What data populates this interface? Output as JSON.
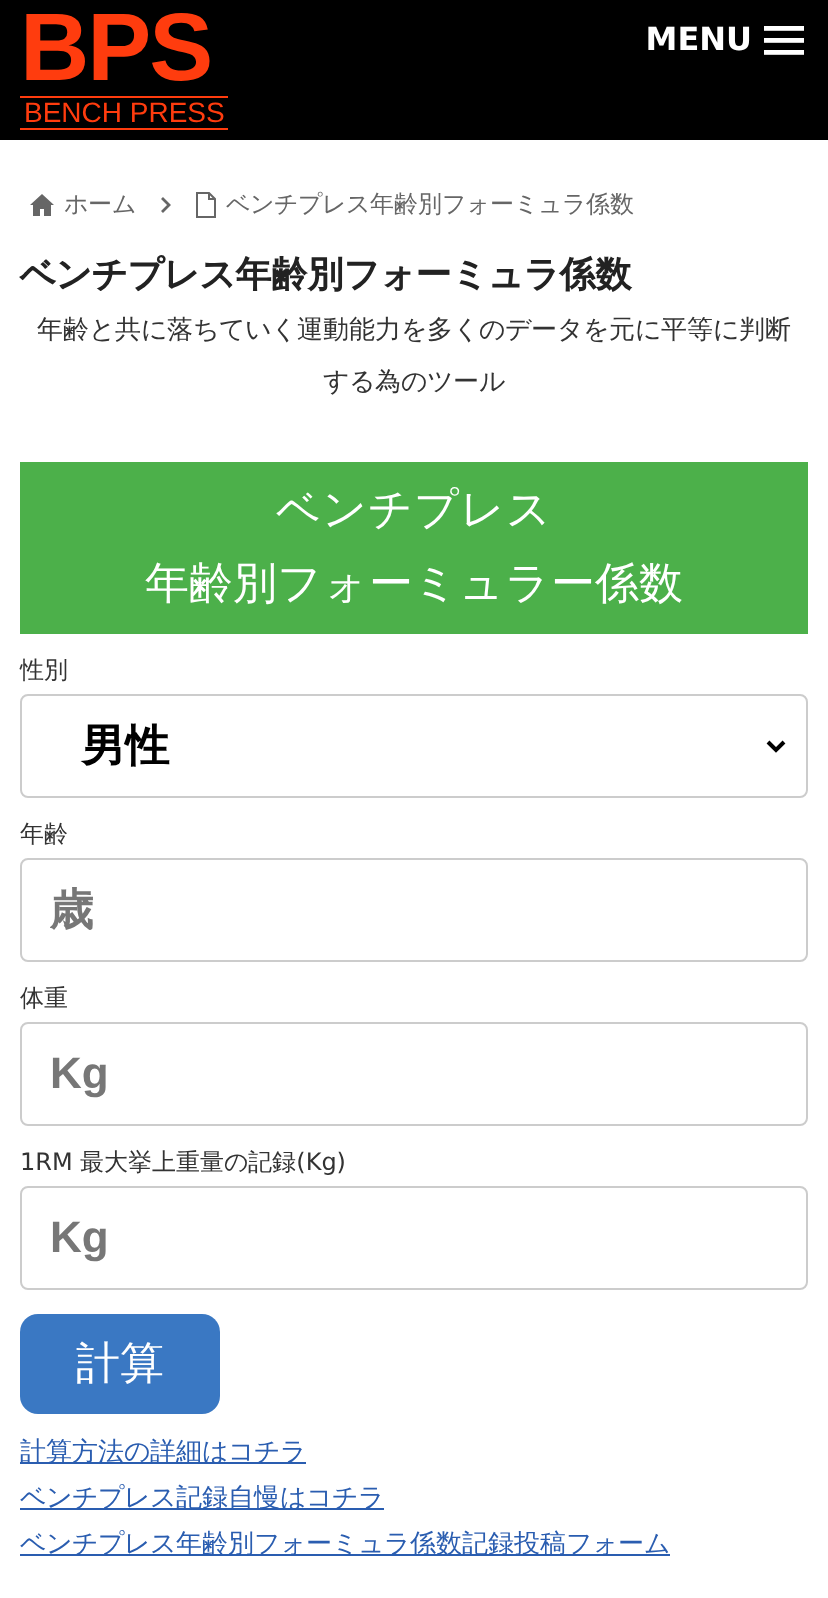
{
  "header": {
    "logo": {
      "title": "BPS",
      "subtitle": "BENCH PRESS"
    },
    "menu_label": "MENU"
  },
  "breadcrumb": [
    {
      "label": "ホーム",
      "kind": "home"
    },
    {
      "label": "ベンチプレス年齢別フォーミュラ係数",
      "kind": "page"
    }
  ],
  "title": "ベンチプレス年齢別フォーミュラ係数",
  "description": "年齢と共に落ちていく運動能力を多くのデータを元に平等に判断する為のツール",
  "banner": [
    "ベンチプレス",
    "年齢別フォーミュラー係数"
  ],
  "fields": [
    {
      "kind": "select",
      "label": "性別",
      "value": "男性"
    },
    {
      "kind": "input",
      "label": "年齢",
      "placeholder": "歳"
    },
    {
      "kind": "input",
      "label": "体重",
      "placeholder": "Kg"
    },
    {
      "kind": "input",
      "label": "1RM 最大挙上重量の記録(Kg)",
      "placeholder": "Kg"
    }
  ],
  "button": "計算",
  "links": [
    "計算方法の詳細はコチラ",
    "ベンチプレス記録自慢はコチラ",
    "ベンチプレス年齢別フォーミュラ係数記録投稿フォーム"
  ]
}
